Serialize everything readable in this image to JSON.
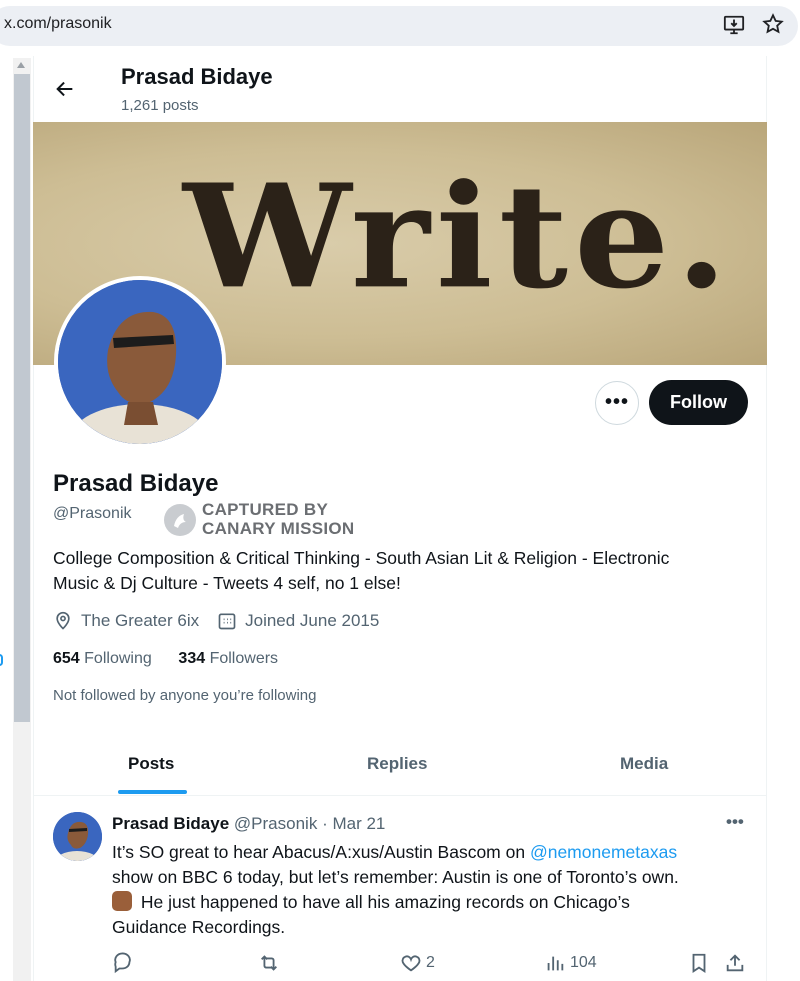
{
  "browser": {
    "url": "x.com/prasonik"
  },
  "header": {
    "name": "Prasad Bidaye",
    "posts_count": "1,261 posts"
  },
  "banner": {
    "text": "Write."
  },
  "actions": {
    "more_label": "•••",
    "follow_label": "Follow"
  },
  "profile": {
    "name": "Prasad Bidaye",
    "handle": "@Prasonik",
    "badge_line1": "CAPTURED BY",
    "badge_line2": "CANARY MISSION",
    "bio_line1": "College Composition & Critical Thinking - South Asian Lit & Religion - Electronic",
    "bio_line2": "Music & Dj Culture - Tweets 4 self, no 1 else!",
    "location": "The Greater 6ix",
    "joined": "Joined June 2015",
    "following_count": "654",
    "following_label": "Following",
    "followers_count": "334",
    "followers_label": "Followers",
    "not_followed": "Not followed by anyone you’re following"
  },
  "tabs": [
    {
      "label": "Posts",
      "active": true
    },
    {
      "label": "Replies",
      "active": false
    },
    {
      "label": "Media",
      "active": false
    }
  ],
  "post": {
    "name": "Prasad Bidaye",
    "handle": "@Prasonik",
    "separator": "·",
    "date": "Mar 21",
    "more": "•••",
    "text_a": "It’s SO great to hear Abacus/A:xus/Austin Bascom on ",
    "mention": "@nemonemetaxas",
    "text_b": "show on BBC 6 today, but let’s remember: Austin is one of Toronto’s own.",
    "text_c": " He just happened to have all his amazing records on Chicago’s",
    "text_d": "Guidance Recordings.",
    "likes": "2",
    "views": "104"
  },
  "colors": {
    "accent": "#1d9bf0",
    "text": "#0f1419",
    "muted": "#536471"
  }
}
